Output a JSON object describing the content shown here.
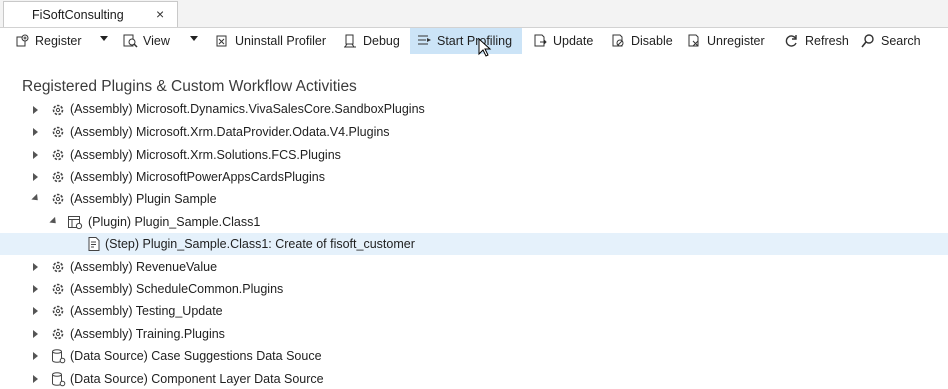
{
  "tab": {
    "title": "FiSoftConsulting",
    "close": "×"
  },
  "toolbar": {
    "register": "Register",
    "view": "View",
    "uninstall_profiler": "Uninstall Profiler",
    "debug": "Debug",
    "start_profiling": "Start Profiling",
    "update": "Update",
    "disable": "Disable",
    "unregister": "Unregister",
    "refresh": "Refresh",
    "search": "Search"
  },
  "section_title": "Registered Plugins & Custom Workflow Activities",
  "tree": {
    "partial_top": "(Assembly) Microsoft.Dynamics.VivaSalesCore.SandboxPlugins",
    "rows": [
      "(Assembly) Microsoft.Xrm.DataProvider.Odata.V4.Plugins",
      "(Assembly) Microsoft.Xrm.Solutions.FCS.Plugins",
      "(Assembly) MicrosoftPowerAppsCardsPlugins",
      "(Assembly) Plugin Sample",
      "(Plugin) Plugin_Sample.Class1",
      "(Step) Plugin_Sample.Class1: Create of fisoft_customer",
      "(Assembly) RevenueValue",
      "(Assembly) ScheduleCommon.Plugins",
      "(Assembly) Testing_Update",
      "(Assembly) Training.Plugins",
      "(Data Source) Case Suggestions Data Souce",
      "(Data Source) Component Layer Data Source"
    ]
  },
  "colors": {
    "hover": "#cce4f7",
    "selected_row": "#e5f1fb"
  }
}
